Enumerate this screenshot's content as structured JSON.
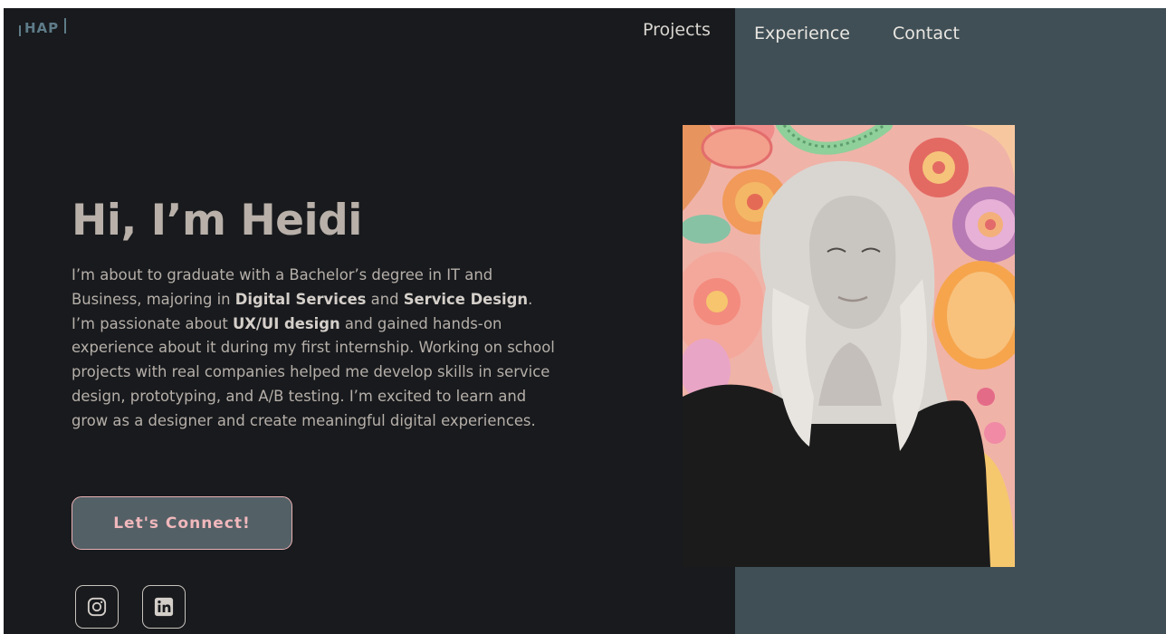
{
  "brand": {
    "logo_text": "HAP"
  },
  "nav": {
    "items": [
      "Projects",
      "Experience",
      "Contact"
    ]
  },
  "hero": {
    "title": "Hi, I’m Heidi",
    "intro": {
      "p1": "I’m about to graduate with a Bachelor’s degree in IT and Business, majoring in ",
      "b1": "Digital Services",
      "p2": " and ",
      "b2": "Service Design",
      "p3": ". I’m passionate about ",
      "b3": "UX/UI design",
      "p4": " and gained hands-on experience about it during my first internship. Working on school projects with real companies helped me develop skills in service design, prototyping, and A/B testing. I’m excited to learn and grow as a designer and create meaningful digital experiences."
    },
    "cta_label": "Let's Connect!"
  },
  "social": {
    "icons": [
      "instagram-icon",
      "linkedin-icon"
    ]
  },
  "colors": {
    "background_dark": "#181a1d",
    "panel": "#404f56",
    "accent_pink": "#f0b8bc",
    "heading": "#b8b0a9"
  }
}
